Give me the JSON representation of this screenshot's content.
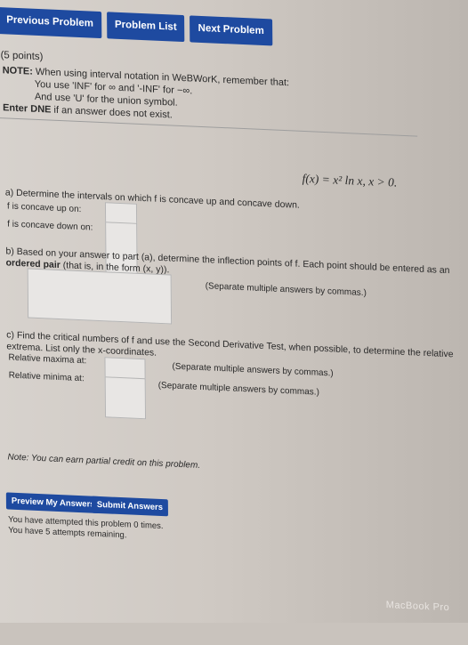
{
  "nav": {
    "previous": "Previous Problem",
    "list": "Problem List",
    "next": "Next Problem"
  },
  "points": "(5 points)",
  "note": {
    "bold": "NOTE:",
    "line1": " When using interval notation in WeBWorK, remember that:",
    "line2": "You use 'INF' for ∞ and '-INF' for −∞.",
    "line3": "And use 'U' for the union symbol.",
    "line4_bold": "Enter DNE",
    "line4": " if an answer does not exist."
  },
  "function": "f(x) = x² ln x,   x > 0.",
  "part_a": {
    "prompt": "a) Determine the intervals on which f is concave up and concave down.",
    "up_label": "f is concave up on:",
    "down_label": "f is concave down on:"
  },
  "part_b": {
    "prompt": "b) Based on your answer to part (a), determine the inflection points of f. Each point should be entered as an",
    "prompt_bold": "ordered pair",
    "prompt_end": "(that is, in the form (x, y)).",
    "hint": "(Separate multiple answers by commas.)"
  },
  "part_c": {
    "prompt": "c) Find the critical numbers of f and use the Second Derivative Test, when possible, to determine the relative extrema. List only the x-coordinates.",
    "max_label": "Relative maxima at:",
    "min_label": "Relative minima at:",
    "hint": "(Separate multiple answers by commas.)"
  },
  "partial_credit": "Note: You can earn partial credit on this problem.",
  "buttons": {
    "preview": "Preview My Answers",
    "submit": "Submit Answers"
  },
  "status": {
    "attempted": "You have attempted this problem 0 times.",
    "remaining": "You have 5 attempts remaining."
  },
  "watermark": "MacBook Pro",
  "colors": {
    "button_blue": "#1e4aa0",
    "background": "#d2ccc6"
  }
}
